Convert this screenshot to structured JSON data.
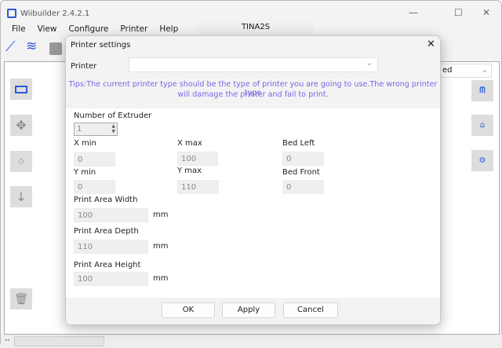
{
  "app": {
    "title": "Wiibuilder 2.4.2.1",
    "tab": "TINA2S",
    "menu": [
      "File",
      "View",
      "Configure",
      "Printer",
      "Help"
    ],
    "right_select": "ed"
  },
  "dialog": {
    "title": "Printer settings",
    "printer_label": "Printer",
    "printer_value": "",
    "tips_line1": "Tips:The current printer type should be the type of printer you are going to use.The wrong printer type",
    "tips_line2": "will damage the printer and fail to print.",
    "extruder_label": "Number of Extruder",
    "extruder_value": "1",
    "x_min_label": "X min",
    "x_min": "0",
    "x_max_label": "X max",
    "x_max": "100",
    "bed_left_label": "Bed Left",
    "bed_left": "0",
    "y_min_label": "Y min",
    "y_min": "0",
    "y_max_label": "Y max",
    "y_max": "110",
    "bed_front_label": "Bed Front",
    "bed_front": "0",
    "width_label": "Print Area Width",
    "width": "100",
    "depth_label": "Print Area Depth",
    "depth": "110",
    "height_label": "Print Area Height",
    "height": "100",
    "unit": "mm",
    "ok": "OK",
    "apply": "Apply",
    "cancel": "Cancel"
  },
  "status": {
    "text": "--"
  },
  "colors": {
    "accent": "#2f5bd8",
    "tips": "#7a68e6"
  }
}
